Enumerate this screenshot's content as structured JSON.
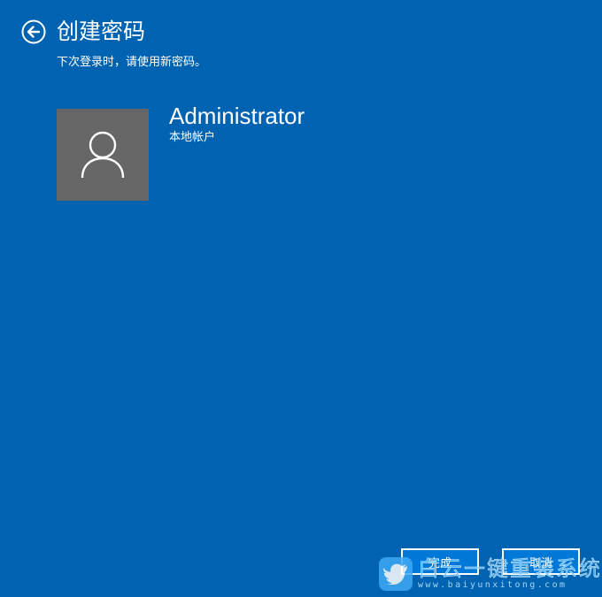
{
  "header": {
    "title": "创建密码",
    "subtitle": "下次登录时，请使用新密码。"
  },
  "account": {
    "name": "Administrator",
    "type": "本地帐户"
  },
  "buttons": {
    "finish": "完成",
    "cancel": "取消"
  },
  "watermark": {
    "title": "白云一键重装系统",
    "url": "www.baiyunxitong.com"
  },
  "colors": {
    "background": "#0063B1",
    "avatar_bg": "#676767",
    "button_bg": "#0078D7"
  },
  "icons": {
    "back": "back-arrow-icon",
    "user": "user-icon",
    "logo": "bird-logo-icon"
  }
}
